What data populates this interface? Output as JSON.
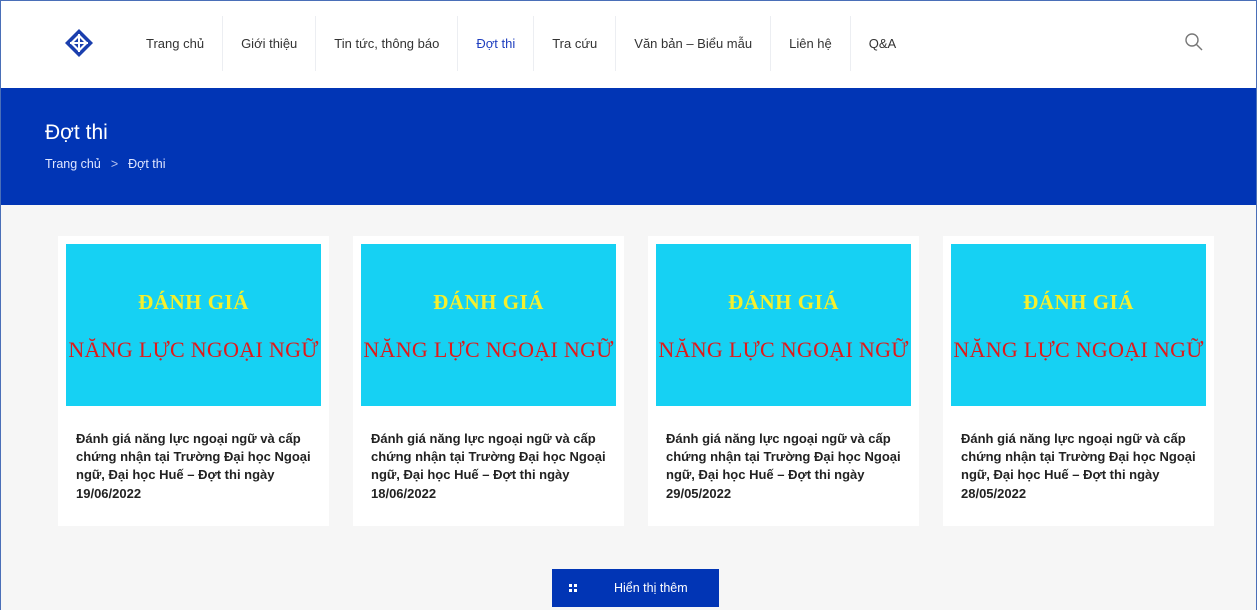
{
  "nav": {
    "items": [
      {
        "label": "Trang chủ",
        "name": "nav-home",
        "active": false
      },
      {
        "label": "Giới thiệu",
        "name": "nav-about",
        "active": false
      },
      {
        "label": "Tin tức, thông báo",
        "name": "nav-news",
        "active": false
      },
      {
        "label": "Đợt thi",
        "name": "nav-exam-rounds",
        "active": true
      },
      {
        "label": "Tra cứu",
        "name": "nav-lookup",
        "active": false
      },
      {
        "label": "Văn bản – Biểu mẫu",
        "name": "nav-documents",
        "active": false
      },
      {
        "label": "Liên hệ",
        "name": "nav-contact",
        "active": false
      },
      {
        "label": "Q&A",
        "name": "nav-qa",
        "active": false
      }
    ],
    "logo_icon": "diamond-logo-icon",
    "search_icon": "search-icon",
    "active_color": "#1f3fbf"
  },
  "hero": {
    "title": "Đợt thi",
    "breadcrumb": [
      "Trang chủ",
      "Đợt thi"
    ],
    "separator": ">",
    "background": "#0135b5"
  },
  "cards": [
    {
      "image_line1": "ĐÁNH GIÁ",
      "image_line2": "NĂNG LỰC NGOẠI NGỮ",
      "title": "Đánh giá năng lực ngoại ngữ và cấp chứng nhận tại Trường Đại học Ngoại ngữ, Đại học Huế – Đợt thi ngày 19/06/2022"
    },
    {
      "image_line1": "ĐÁNH GIÁ",
      "image_line2": "NĂNG LỰC NGOẠI NGỮ",
      "title": "Đánh giá năng lực ngoại ngữ và cấp chứng nhận tại Trường Đại học Ngoại ngữ, Đại học Huế – Đợt thi ngày 18/06/2022"
    },
    {
      "image_line1": "ĐÁNH GIÁ",
      "image_line2": "NĂNG LỰC NGOẠI NGỮ",
      "title": "Đánh giá năng lực ngoại ngữ và cấp chứng nhận tại Trường Đại học Ngoại ngữ, Đại học Huế – Đợt thi ngày 29/05/2022"
    },
    {
      "image_line1": "ĐÁNH GIÁ",
      "image_line2": "NĂNG LỰC NGOẠI NGỮ",
      "title": "Đánh giá năng lực ngoại ngữ và cấp chứng nhận tại Trường Đại học Ngoại ngữ, Đại học Huế – Đợt thi ngày 28/05/2022"
    }
  ],
  "colors": {
    "card_image_bg": "#16d1f3",
    "card_image_line1": "#f6ef2c",
    "card_image_line2": "#e01a1a"
  },
  "load_more": {
    "label": "Hiển thị thêm",
    "icon": "grid-icon"
  }
}
